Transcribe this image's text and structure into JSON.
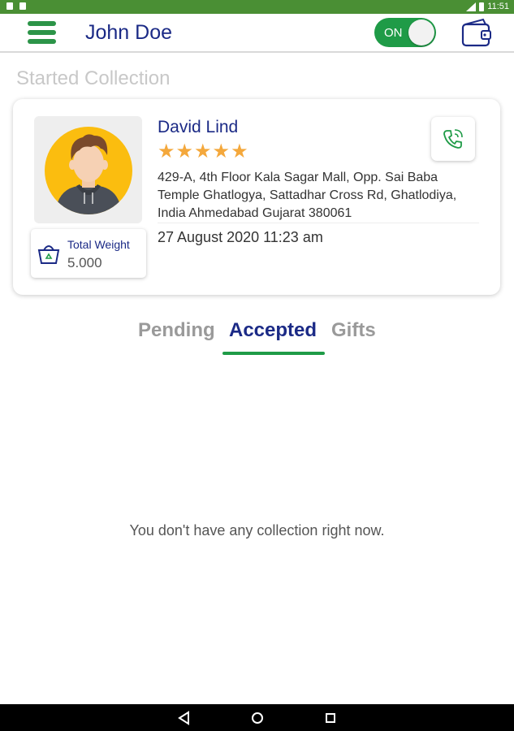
{
  "status_bar": {
    "time": "11:51"
  },
  "header": {
    "user_name": "John Doe",
    "toggle_label": "ON",
    "menu_icon": "hamburger-menu-icon",
    "wallet_icon": "wallet-icon"
  },
  "section_title": "Started Collection",
  "card": {
    "customer_name": "David Lind",
    "rating": 5,
    "address": "429-A, 4th Floor Kala Sagar Mall,  Opp. Sai Baba Temple Ghatlogya,  Sattadhar Cross Rd, Ghatlodiya,  India Ahmedabad Gujarat 380061",
    "datetime": "27 August 2020 11:23 am",
    "weight_label": "Total Weight",
    "weight_value": "5.000",
    "call_icon": "phone-call-icon"
  },
  "tabs": [
    {
      "label": "Pending",
      "active": false
    },
    {
      "label": "Accepted",
      "active": true
    },
    {
      "label": "Gifts",
      "active": false
    }
  ],
  "empty_message": "You don't have any collection right now.",
  "colors": {
    "status_bar": "#4a8f34",
    "accent_green": "#1f9b47",
    "primary_navy": "#1b2a86",
    "star": "#f4a83c"
  }
}
